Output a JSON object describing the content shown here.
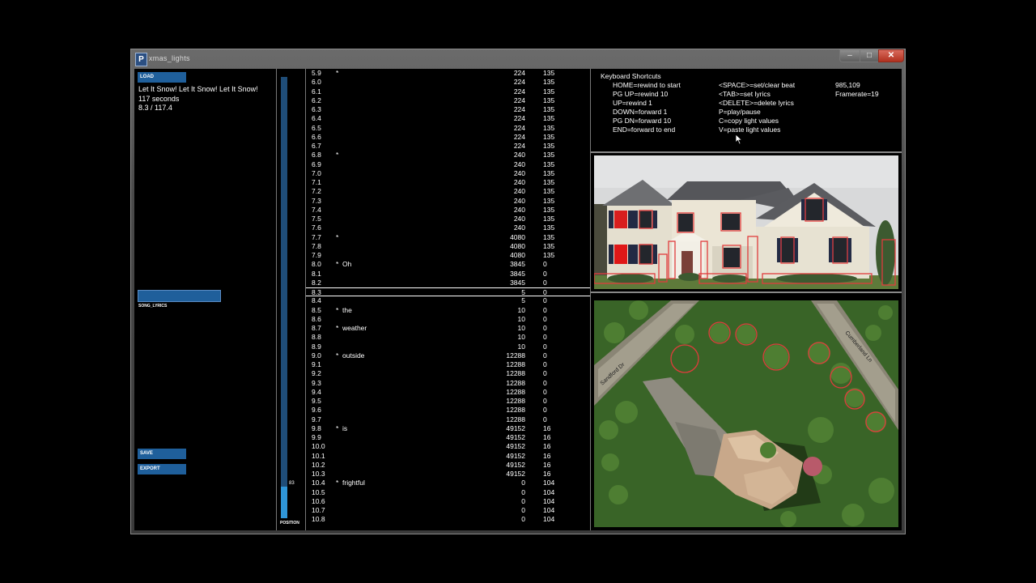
{
  "window": {
    "title": "xmas_lights",
    "app_icon": "P"
  },
  "left": {
    "load_label": "LOAD",
    "song_title": "Let It Snow! Let It Snow! Let It Snow!",
    "song_length": "117 seconds",
    "progress": "8.3 / 117.4",
    "lyrics_label": "SONG_LYRICS",
    "save_label": "SAVE",
    "export_label": "EXPORT"
  },
  "slider": {
    "value": "83",
    "label": "POSITION",
    "fraction": 0.071
  },
  "rows": [
    {
      "t": "5.9",
      "star": "*",
      "lyric": "",
      "v1": "224",
      "v2": "135"
    },
    {
      "t": "6.0",
      "star": "",
      "lyric": "",
      "v1": "224",
      "v2": "135"
    },
    {
      "t": "6.1",
      "star": "",
      "lyric": "",
      "v1": "224",
      "v2": "135"
    },
    {
      "t": "6.2",
      "star": "",
      "lyric": "",
      "v1": "224",
      "v2": "135"
    },
    {
      "t": "6.3",
      "star": "",
      "lyric": "",
      "v1": "224",
      "v2": "135"
    },
    {
      "t": "6.4",
      "star": "",
      "lyric": "",
      "v1": "224",
      "v2": "135"
    },
    {
      "t": "6.5",
      "star": "",
      "lyric": "",
      "v1": "224",
      "v2": "135"
    },
    {
      "t": "6.6",
      "star": "",
      "lyric": "",
      "v1": "224",
      "v2": "135"
    },
    {
      "t": "6.7",
      "star": "",
      "lyric": "",
      "v1": "224",
      "v2": "135"
    },
    {
      "t": "6.8",
      "star": "*",
      "lyric": "",
      "v1": "240",
      "v2": "135"
    },
    {
      "t": "6.9",
      "star": "",
      "lyric": "",
      "v1": "240",
      "v2": "135"
    },
    {
      "t": "7.0",
      "star": "",
      "lyric": "",
      "v1": "240",
      "v2": "135"
    },
    {
      "t": "7.1",
      "star": "",
      "lyric": "",
      "v1": "240",
      "v2": "135"
    },
    {
      "t": "7.2",
      "star": "",
      "lyric": "",
      "v1": "240",
      "v2": "135"
    },
    {
      "t": "7.3",
      "star": "",
      "lyric": "",
      "v1": "240",
      "v2": "135"
    },
    {
      "t": "7.4",
      "star": "",
      "lyric": "",
      "v1": "240",
      "v2": "135"
    },
    {
      "t": "7.5",
      "star": "",
      "lyric": "",
      "v1": "240",
      "v2": "135"
    },
    {
      "t": "7.6",
      "star": "",
      "lyric": "",
      "v1": "240",
      "v2": "135"
    },
    {
      "t": "7.7",
      "star": "*",
      "lyric": "",
      "v1": "4080",
      "v2": "135"
    },
    {
      "t": "7.8",
      "star": "",
      "lyric": "",
      "v1": "4080",
      "v2": "135"
    },
    {
      "t": "7.9",
      "star": "",
      "lyric": "",
      "v1": "4080",
      "v2": "135"
    },
    {
      "t": "8.0",
      "star": "*",
      "lyric": "Oh",
      "v1": "3845",
      "v2": "0"
    },
    {
      "t": "8.1",
      "star": "",
      "lyric": "",
      "v1": "3845",
      "v2": "0"
    },
    {
      "t": "8.2",
      "star": "",
      "lyric": "",
      "v1": "3845",
      "v2": "0"
    },
    {
      "t": "8.3",
      "star": "",
      "lyric": "",
      "v1": "5",
      "v2": "0",
      "selected": true
    },
    {
      "t": "8.4",
      "star": "",
      "lyric": "",
      "v1": "5",
      "v2": "0"
    },
    {
      "t": "8.5",
      "star": "*",
      "lyric": "the",
      "v1": "10",
      "v2": "0"
    },
    {
      "t": "8.6",
      "star": "",
      "lyric": "",
      "v1": "10",
      "v2": "0"
    },
    {
      "t": "8.7",
      "star": "*",
      "lyric": "weather",
      "v1": "10",
      "v2": "0"
    },
    {
      "t": "8.8",
      "star": "",
      "lyric": "",
      "v1": "10",
      "v2": "0"
    },
    {
      "t": "8.9",
      "star": "",
      "lyric": "",
      "v1": "10",
      "v2": "0"
    },
    {
      "t": "9.0",
      "star": "*",
      "lyric": "outside",
      "v1": "12288",
      "v2": "0"
    },
    {
      "t": "9.1",
      "star": "",
      "lyric": "",
      "v1": "12288",
      "v2": "0"
    },
    {
      "t": "9.2",
      "star": "",
      "lyric": "",
      "v1": "12288",
      "v2": "0"
    },
    {
      "t": "9.3",
      "star": "",
      "lyric": "",
      "v1": "12288",
      "v2": "0"
    },
    {
      "t": "9.4",
      "star": "",
      "lyric": "",
      "v1": "12288",
      "v2": "0"
    },
    {
      "t": "9.5",
      "star": "",
      "lyric": "",
      "v1": "12288",
      "v2": "0"
    },
    {
      "t": "9.6",
      "star": "",
      "lyric": "",
      "v1": "12288",
      "v2": "0"
    },
    {
      "t": "9.7",
      "star": "",
      "lyric": "",
      "v1": "12288",
      "v2": "0"
    },
    {
      "t": "9.8",
      "star": "*",
      "lyric": "is",
      "v1": "49152",
      "v2": "16"
    },
    {
      "t": "9.9",
      "star": "",
      "lyric": "",
      "v1": "49152",
      "v2": "16"
    },
    {
      "t": "10.0",
      "star": "",
      "lyric": "",
      "v1": "49152",
      "v2": "16"
    },
    {
      "t": "10.1",
      "star": "",
      "lyric": "",
      "v1": "49152",
      "v2": "16"
    },
    {
      "t": "10.2",
      "star": "",
      "lyric": "",
      "v1": "49152",
      "v2": "16"
    },
    {
      "t": "10.3",
      "star": "",
      "lyric": "",
      "v1": "49152",
      "v2": "16"
    },
    {
      "t": "10.4",
      "star": "*",
      "lyric": "frightful",
      "v1": "0",
      "v2": "104"
    },
    {
      "t": "10.5",
      "star": "",
      "lyric": "",
      "v1": "0",
      "v2": "104"
    },
    {
      "t": "10.6",
      "star": "",
      "lyric": "",
      "v1": "0",
      "v2": "104"
    },
    {
      "t": "10.7",
      "star": "",
      "lyric": "",
      "v1": "0",
      "v2": "104"
    },
    {
      "t": "10.8",
      "star": "",
      "lyric": "",
      "v1": "0",
      "v2": "104"
    }
  ],
  "shortcuts": {
    "title": "Keyboard Shortcuts",
    "col1": [
      "HOME=rewind to start",
      "PG UP=rewind 10",
      "UP=rewind 1",
      "DOWN=forward 1",
      "PG DN=forward 10",
      "END=forward to end"
    ],
    "col2": [
      "<SPACE>=set/clear beat",
      "<TAB>=set lyrics",
      "<DELETE>=delete lyrics",
      "P=play/pause",
      "C=copy light values",
      "V=paste light values"
    ],
    "col3": [
      "985,109",
      "Framerate=19"
    ]
  },
  "map_labels": {
    "street_left": "Sandford Dr",
    "street_right": "Cumberland Ln"
  },
  "colors": {
    "accent": "#1f5f9b",
    "slider_fill": "#2f96d8",
    "light_outline": "#e03c3c"
  }
}
